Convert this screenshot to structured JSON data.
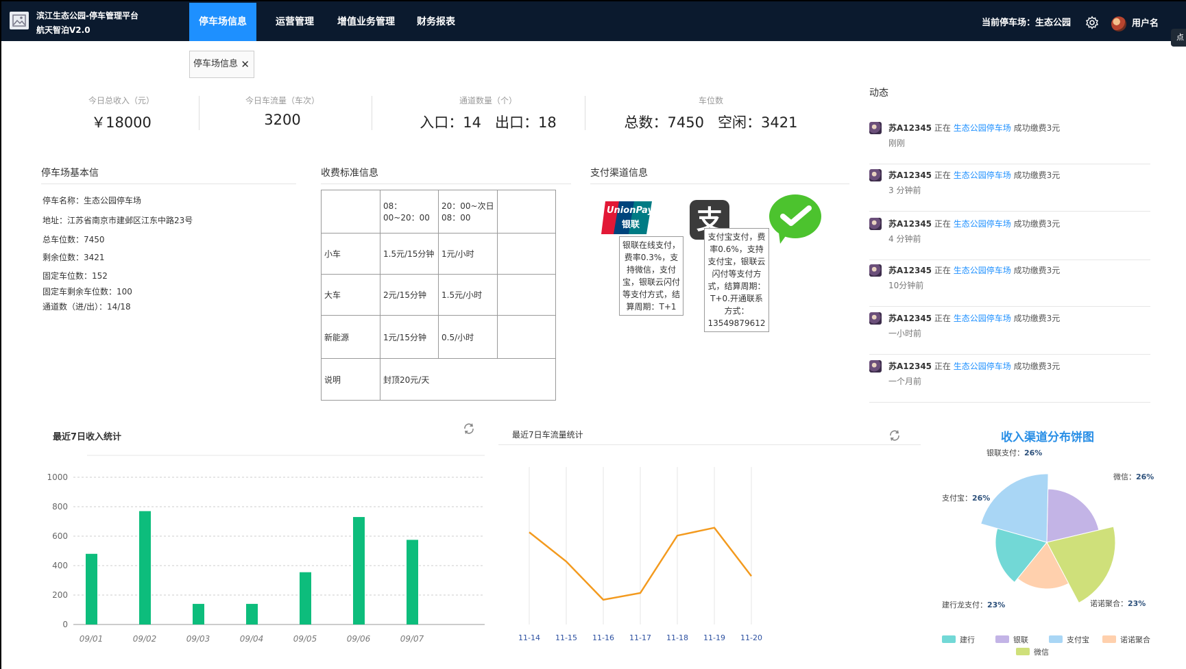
{
  "header": {
    "title": "滨江生态公园-停车管理平台",
    "subtitle": "航天智泊V2.0",
    "nav": [
      "停车场信息",
      "运营管理",
      "增值业务管理",
      "财务报表"
    ],
    "current_park_label": "当前停车场：生态公园",
    "username": "用户名",
    "edge_tab": "点"
  },
  "tag": {
    "label": "停车场信息",
    "close": "✕"
  },
  "stats": [
    {
      "label": "今日总收入（元）",
      "value": "￥18000"
    },
    {
      "label": "今日车流量（车次）",
      "value": "3200"
    },
    {
      "label": "通道数量（个）",
      "value": "入口：14   出口：18"
    },
    {
      "label": "车位数",
      "value": "总数：7450   空闲：3421"
    }
  ],
  "basic": {
    "title": "停车场基本信",
    "lines": [
      "停车名称：生态公园停车场",
      "地址：江苏省南京市建邺区江东中路23号",
      "总车位数：7450",
      "剩余位数：3421",
      "固定车位数：152",
      "固定车剩余车位数：100",
      "通道数（进/出）：14/18"
    ]
  },
  "fee": {
    "title": "收费标准信息",
    "head": [
      "",
      "08：00~20：00",
      "20：00~次日08：00",
      ""
    ],
    "rows": [
      [
        "小车",
        "1.5元/15分钟",
        "1元/小时",
        ""
      ],
      [
        "大车",
        "2元/15分钟",
        "1.5元/小时",
        ""
      ],
      [
        "新能源",
        "1元/15分钟",
        "0.5/小时",
        ""
      ]
    ],
    "note_label": "说明",
    "note_value": "封顶20元/天"
  },
  "payment": {
    "title": "支付渠道信息",
    "unionpay_logo_text": "UnionPay",
    "unionpay_logo_cn": "银联",
    "alipay_glyph": "支",
    "unionpay_tip": "银联在线支付，费率0.3%，支持微信，支付宝，银联云闪付等支付方式，结算周期：T+1",
    "alipay_tip": "支付宝支付，费率0.6%，支持支付宝，银联云闪付等支付方式，结算周期：T+0.开通联系方式：13549879612"
  },
  "activity": {
    "title": "动态",
    "items": [
      {
        "plate": "苏A12345",
        "pre": "正在",
        "place": "生态公园停车场",
        "post": "成功缴费3元",
        "time": "刚刚"
      },
      {
        "plate": "苏A12345",
        "pre": "正在",
        "place": "生态公园停车场",
        "post": "成功缴费3元",
        "time": "3 分钟前"
      },
      {
        "plate": "苏A12345",
        "pre": "正在",
        "place": "生态公园停车场",
        "post": "成功缴费3元",
        "time": "4 分钟前"
      },
      {
        "plate": "苏A12345",
        "pre": "正在",
        "place": "生态公园停车场",
        "post": "成功缴费3元",
        "time": "10分钟前"
      },
      {
        "plate": "苏A12345",
        "pre": "正在",
        "place": "生态公园停车场",
        "post": "成功缴费3元",
        "time": "一小时前"
      },
      {
        "plate": "苏A12345",
        "pre": "正在",
        "place": "生态公园停车场",
        "post": "成功缴费3元",
        "time": "一个月前"
      }
    ]
  },
  "colors": {
    "nav_bg": "#0b1a2e",
    "accent": "#1e90ff",
    "bar": "#0dbd7c",
    "line": "#f39a1e"
  },
  "chart_data": [
    {
      "type": "bar",
      "title": "最近7日收入统计",
      "categories": [
        "09/01",
        "09/02",
        "09/03",
        "09/04",
        "09/05",
        "09/06",
        "09/07"
      ],
      "values": [
        480,
        770,
        140,
        140,
        355,
        730,
        575
      ],
      "yticks": [
        0,
        200,
        400,
        600,
        800,
        1000
      ],
      "ylim": [
        0,
        1000
      ]
    },
    {
      "type": "line",
      "title": "最近7日车流量统计",
      "categories": [
        "11-14",
        "11-15",
        "11-16",
        "11-17",
        "11-18",
        "11-19",
        "11-20"
      ],
      "values": [
        820,
        560,
        220,
        280,
        790,
        860,
        430
      ]
    },
    {
      "type": "pie",
      "title": "收入渠道分布饼图",
      "slices": [
        {
          "name": "银联支付",
          "legend": "银联",
          "value": 26,
          "label": "26%",
          "color": "#c3b4e6"
        },
        {
          "name": "微信",
          "legend": "微信",
          "value": 26,
          "label": "26%",
          "color": "#cfe07a"
        },
        {
          "name": "诺诺聚合",
          "legend": "诺诺聚合",
          "value": 23,
          "label": "23%",
          "color": "#ffd0ad"
        },
        {
          "name": "建行龙支付",
          "legend": "建行",
          "value": 23,
          "label": "23%",
          "color": "#72d8d6"
        },
        {
          "name": "支付宝",
          "legend": "支付宝",
          "value": 26,
          "label": "26%",
          "color": "#a9d6f5"
        }
      ]
    }
  ]
}
